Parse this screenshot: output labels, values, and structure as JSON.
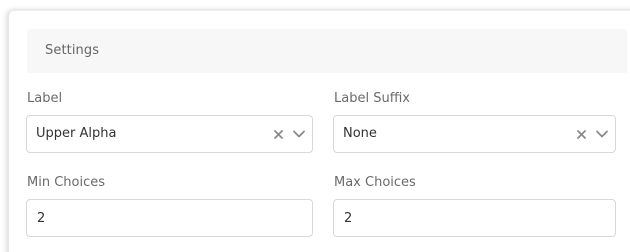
{
  "settings": {
    "title": "Settings"
  },
  "fields": {
    "label": {
      "label": "Label",
      "value": "Upper Alpha"
    },
    "label_suffix": {
      "label": "Label Suffix",
      "value": "None"
    },
    "min_choices": {
      "label": "Min Choices",
      "value": "2"
    },
    "max_choices": {
      "label": "Max Choices",
      "value": "2"
    }
  },
  "icons": {
    "clear": "clear-icon",
    "dropdown": "chevron-down-icon"
  },
  "colors": {
    "header_bg": "#f7f7f7",
    "border": "#d8d8d8",
    "label_text": "#6a6a6a",
    "value_text": "#333333",
    "icon": "#8a8a8a"
  }
}
